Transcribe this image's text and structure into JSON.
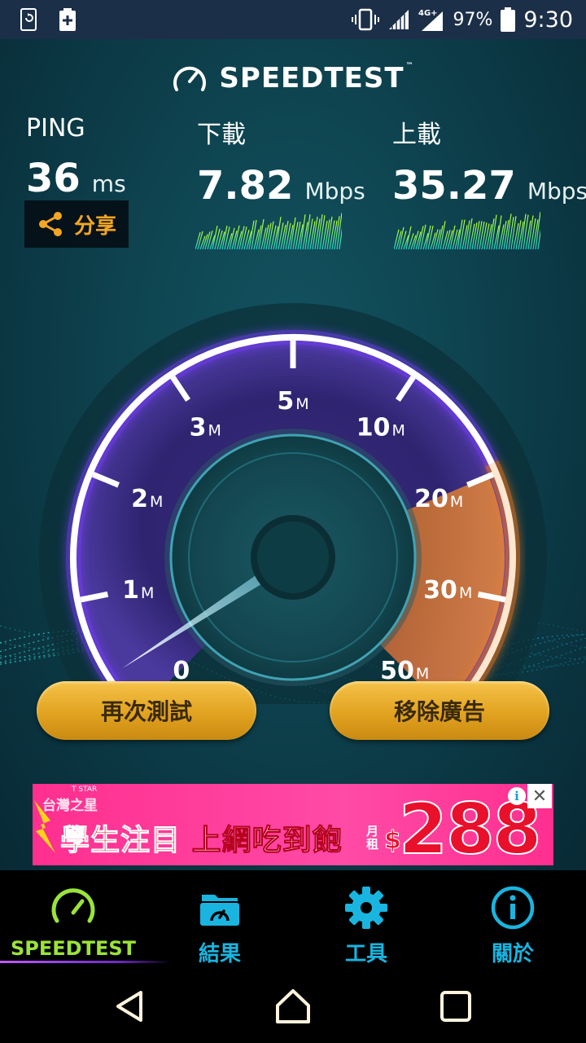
{
  "status_bar": {
    "battery_percent": "97%",
    "time": "9:30",
    "network": "4G+",
    "icons": [
      "screen-rotate-icon",
      "battery-saver-icon",
      "vibrate-icon",
      "signal-icon",
      "signal-4g-icon",
      "battery-icon"
    ]
  },
  "header": {
    "brand": "SPEEDTEST",
    "trademark": "™"
  },
  "metrics": {
    "ping": {
      "label": "PING",
      "value": "36",
      "unit": "ms"
    },
    "download": {
      "label": "下載",
      "value": "7.82",
      "unit": "Mbps"
    },
    "upload": {
      "label": "上載",
      "value": "35.27",
      "unit": "Mbps"
    }
  },
  "share": {
    "label": "分享",
    "icon": "share-icon"
  },
  "gauge": {
    "scale_labels": [
      {
        "num": "0",
        "unit": ""
      },
      {
        "num": "1",
        "unit": "M"
      },
      {
        "num": "2",
        "unit": "M"
      },
      {
        "num": "3",
        "unit": "M"
      },
      {
        "num": "5",
        "unit": "M"
      },
      {
        "num": "10",
        "unit": "M"
      },
      {
        "num": "20",
        "unit": "M"
      },
      {
        "num": "30",
        "unit": "M"
      },
      {
        "num": "50",
        "unit": "M"
      }
    ],
    "scale_values": [
      0,
      1,
      2,
      3,
      5,
      10,
      20,
      30,
      50
    ],
    "current_value": 0,
    "colors": {
      "ring": "#c9a6ff",
      "glow": "#7a3cff",
      "upload_segment": "#f0913a",
      "needle": "#9ff3ff"
    }
  },
  "buttons": {
    "retest": "再次測試",
    "remove_ads": "移除廣告"
  },
  "ad": {
    "small_brand": "T STAR",
    "brand": "台灣之星",
    "headline_red": "學生注目",
    "headline_white": "上網吃到飽",
    "monthly": "月租",
    "currency": "$",
    "price": "288",
    "info": "i",
    "close": "✕"
  },
  "bottom_nav": {
    "items": [
      {
        "label": "SPEEDTEST",
        "icon": "speedometer-icon",
        "active": true
      },
      {
        "label": "結果",
        "icon": "results-folder-icon",
        "active": false
      },
      {
        "label": "工具",
        "icon": "gear-icon",
        "active": false
      },
      {
        "label": "關於",
        "icon": "info-icon",
        "active": false
      }
    ],
    "colors": {
      "active": "#9be33a",
      "inactive": "#19b5e0"
    }
  },
  "system_nav": {
    "icons": [
      "back-icon",
      "home-icon",
      "recents-icon"
    ]
  }
}
